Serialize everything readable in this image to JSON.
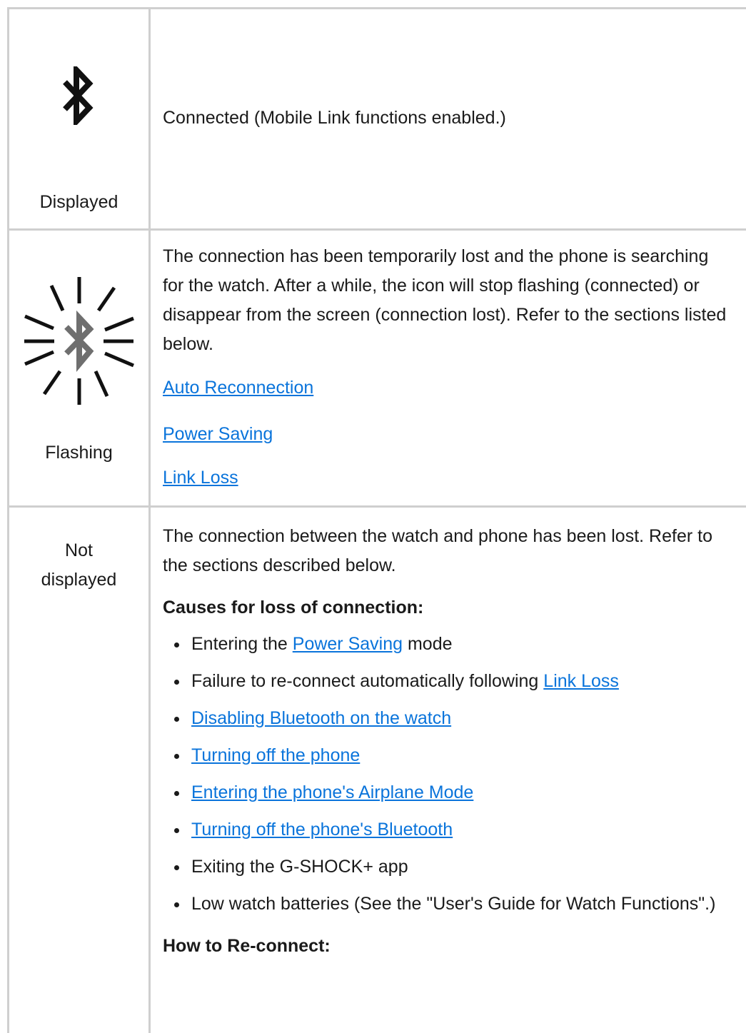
{
  "rows": {
    "displayed": {
      "status": "Displayed",
      "description": "Connected (Mobile Link functions enabled.)"
    },
    "flashing": {
      "status": "Flashing",
      "description": "The connection has been temporarily lost and the phone is searching for the watch. After a while, the icon will stop flashing (connected) or disappear from the screen (connection lost). Refer to the sections listed below.",
      "links": [
        "Auto Reconnection",
        "Power Saving",
        "Link Loss"
      ]
    },
    "not_displayed": {
      "status_line1": "Not",
      "status_line2": "displayed",
      "description": "The connection between the watch and phone has been lost. Refer to the sections described below.",
      "causes_heading": "Causes for loss of connection:",
      "causes": {
        "c1_before": "Entering the ",
        "c1_link": "Power Saving",
        "c1_after": " mode",
        "c2_before": "Failure to re-connect automatically following ",
        "c2_link": "Link Loss",
        "c3_link": "Disabling Bluetooth on the watch",
        "c4_link": "Turning off the phone",
        "c5_link": "Entering the phone's Airplane Mode",
        "c6_link": "Turning off the phone's Bluetooth",
        "c7": "Exiting the G-SHOCK+ app",
        "c8": "Low watch batteries (See the \"User's Guide for Watch Functions\".)"
      },
      "reconnect_heading": "How to Re-connect:"
    }
  },
  "icons": {
    "displayed_icon": "bluetooth-icon",
    "flashing_icon": "bluetooth-flashing-icon"
  },
  "colors": {
    "link": "#0a74db",
    "grid": "#cfcfcf",
    "text": "#1a1a1a"
  }
}
